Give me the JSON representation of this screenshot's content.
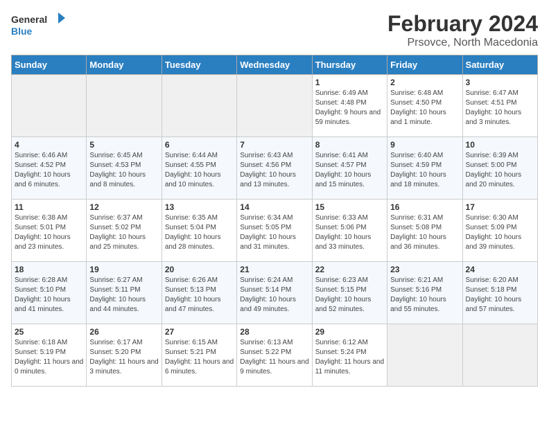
{
  "header": {
    "logo_general": "General",
    "logo_blue": "Blue",
    "title": "February 2024",
    "subtitle": "Prsovce, North Macedonia"
  },
  "days_of_week": [
    "Sunday",
    "Monday",
    "Tuesday",
    "Wednesday",
    "Thursday",
    "Friday",
    "Saturday"
  ],
  "weeks": [
    [
      {
        "day": "",
        "empty": true
      },
      {
        "day": "",
        "empty": true
      },
      {
        "day": "",
        "empty": true
      },
      {
        "day": "",
        "empty": true
      },
      {
        "day": "1",
        "sunrise": "6:49 AM",
        "sunset": "4:48 PM",
        "daylight": "9 hours and 59 minutes."
      },
      {
        "day": "2",
        "sunrise": "6:48 AM",
        "sunset": "4:50 PM",
        "daylight": "10 hours and 1 minute."
      },
      {
        "day": "3",
        "sunrise": "6:47 AM",
        "sunset": "4:51 PM",
        "daylight": "10 hours and 3 minutes."
      }
    ],
    [
      {
        "day": "4",
        "sunrise": "6:46 AM",
        "sunset": "4:52 PM",
        "daylight": "10 hours and 6 minutes."
      },
      {
        "day": "5",
        "sunrise": "6:45 AM",
        "sunset": "4:53 PM",
        "daylight": "10 hours and 8 minutes."
      },
      {
        "day": "6",
        "sunrise": "6:44 AM",
        "sunset": "4:55 PM",
        "daylight": "10 hours and 10 minutes."
      },
      {
        "day": "7",
        "sunrise": "6:43 AM",
        "sunset": "4:56 PM",
        "daylight": "10 hours and 13 minutes."
      },
      {
        "day": "8",
        "sunrise": "6:41 AM",
        "sunset": "4:57 PM",
        "daylight": "10 hours and 15 minutes."
      },
      {
        "day": "9",
        "sunrise": "6:40 AM",
        "sunset": "4:59 PM",
        "daylight": "10 hours and 18 minutes."
      },
      {
        "day": "10",
        "sunrise": "6:39 AM",
        "sunset": "5:00 PM",
        "daylight": "10 hours and 20 minutes."
      }
    ],
    [
      {
        "day": "11",
        "sunrise": "6:38 AM",
        "sunset": "5:01 PM",
        "daylight": "10 hours and 23 minutes."
      },
      {
        "day": "12",
        "sunrise": "6:37 AM",
        "sunset": "5:02 PM",
        "daylight": "10 hours and 25 minutes."
      },
      {
        "day": "13",
        "sunrise": "6:35 AM",
        "sunset": "5:04 PM",
        "daylight": "10 hours and 28 minutes."
      },
      {
        "day": "14",
        "sunrise": "6:34 AM",
        "sunset": "5:05 PM",
        "daylight": "10 hours and 31 minutes."
      },
      {
        "day": "15",
        "sunrise": "6:33 AM",
        "sunset": "5:06 PM",
        "daylight": "10 hours and 33 minutes."
      },
      {
        "day": "16",
        "sunrise": "6:31 AM",
        "sunset": "5:08 PM",
        "daylight": "10 hours and 36 minutes."
      },
      {
        "day": "17",
        "sunrise": "6:30 AM",
        "sunset": "5:09 PM",
        "daylight": "10 hours and 39 minutes."
      }
    ],
    [
      {
        "day": "18",
        "sunrise": "6:28 AM",
        "sunset": "5:10 PM",
        "daylight": "10 hours and 41 minutes."
      },
      {
        "day": "19",
        "sunrise": "6:27 AM",
        "sunset": "5:11 PM",
        "daylight": "10 hours and 44 minutes."
      },
      {
        "day": "20",
        "sunrise": "6:26 AM",
        "sunset": "5:13 PM",
        "daylight": "10 hours and 47 minutes."
      },
      {
        "day": "21",
        "sunrise": "6:24 AM",
        "sunset": "5:14 PM",
        "daylight": "10 hours and 49 minutes."
      },
      {
        "day": "22",
        "sunrise": "6:23 AM",
        "sunset": "5:15 PM",
        "daylight": "10 hours and 52 minutes."
      },
      {
        "day": "23",
        "sunrise": "6:21 AM",
        "sunset": "5:16 PM",
        "daylight": "10 hours and 55 minutes."
      },
      {
        "day": "24",
        "sunrise": "6:20 AM",
        "sunset": "5:18 PM",
        "daylight": "10 hours and 57 minutes."
      }
    ],
    [
      {
        "day": "25",
        "sunrise": "6:18 AM",
        "sunset": "5:19 PM",
        "daylight": "11 hours and 0 minutes."
      },
      {
        "day": "26",
        "sunrise": "6:17 AM",
        "sunset": "5:20 PM",
        "daylight": "11 hours and 3 minutes."
      },
      {
        "day": "27",
        "sunrise": "6:15 AM",
        "sunset": "5:21 PM",
        "daylight": "11 hours and 6 minutes."
      },
      {
        "day": "28",
        "sunrise": "6:13 AM",
        "sunset": "5:22 PM",
        "daylight": "11 hours and 9 minutes."
      },
      {
        "day": "29",
        "sunrise": "6:12 AM",
        "sunset": "5:24 PM",
        "daylight": "11 hours and 11 minutes."
      },
      {
        "day": "",
        "empty": true
      },
      {
        "day": "",
        "empty": true
      }
    ]
  ],
  "labels": {
    "sunrise": "Sunrise:",
    "sunset": "Sunset:",
    "daylight": "Daylight:"
  }
}
